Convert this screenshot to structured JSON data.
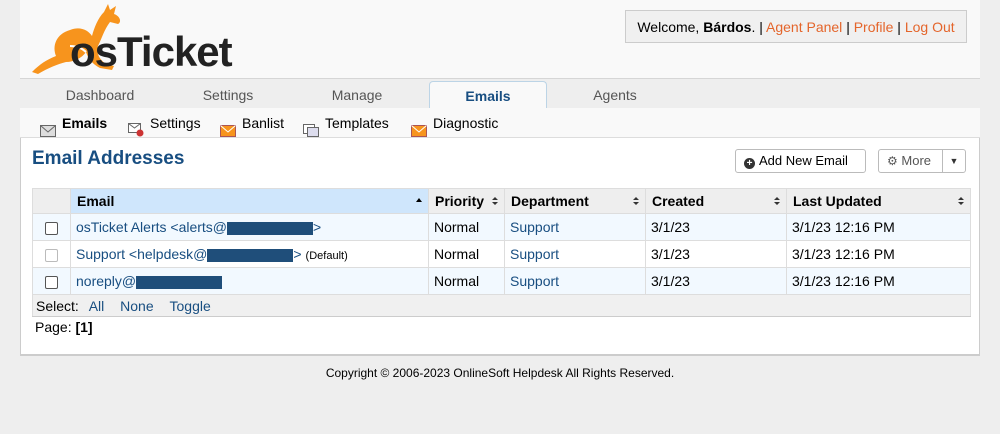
{
  "header": {
    "logo_text": "osTicket",
    "welcome_prefix": "Welcome, ",
    "user_name": "Bárdos",
    "welcome_suffix": ".",
    "sep": "|",
    "links": [
      "Agent Panel",
      "Profile",
      "Log Out"
    ]
  },
  "nav": {
    "tabs": [
      "Dashboard",
      "Settings",
      "Manage",
      "Emails",
      "Agents"
    ],
    "active": "Emails"
  },
  "subnav": {
    "items": [
      {
        "label": "Emails",
        "icon": "envelope-icon"
      },
      {
        "label": "Settings",
        "icon": "mail-settings-icon"
      },
      {
        "label": "Banlist",
        "icon": "banlist-icon"
      },
      {
        "label": "Templates",
        "icon": "templates-icon"
      },
      {
        "label": "Diagnostic",
        "icon": "diagnostic-icon"
      }
    ]
  },
  "main": {
    "title": "Email Addresses",
    "add_button": "Add New Email",
    "more_button": "More",
    "columns": [
      "Email",
      "Priority",
      "Department",
      "Created",
      "Last Updated"
    ],
    "rows": [
      {
        "email_prefix": "osTicket Alerts <alerts@",
        "email_suffix": ">",
        "default": "",
        "priority": "Normal",
        "department": "Support",
        "created": "3/1/23",
        "updated": "3/1/23 12:16 PM"
      },
      {
        "email_prefix": "Support <helpdesk@",
        "email_suffix": ">",
        "default": "(Default)",
        "priority": "Normal",
        "department": "Support",
        "created": "3/1/23",
        "updated": "3/1/23 12:16 PM"
      },
      {
        "email_prefix": "noreply@",
        "email_suffix": "",
        "default": "",
        "priority": "Normal",
        "department": "Support",
        "created": "3/1/23",
        "updated": "3/1/23 12:16 PM"
      }
    ],
    "select_label": "Select:",
    "select_links": [
      "All",
      "None",
      "Toggle"
    ],
    "page_label": "Page:",
    "page_current": "[1]"
  },
  "footer": {
    "copyright": "Copyright © 2006-2023 OnlineSoft Helpdesk All Rights Reserved."
  },
  "colors": {
    "link": "#184e81",
    "accent_orange": "#f7941d",
    "header_link": "#e4652b"
  }
}
